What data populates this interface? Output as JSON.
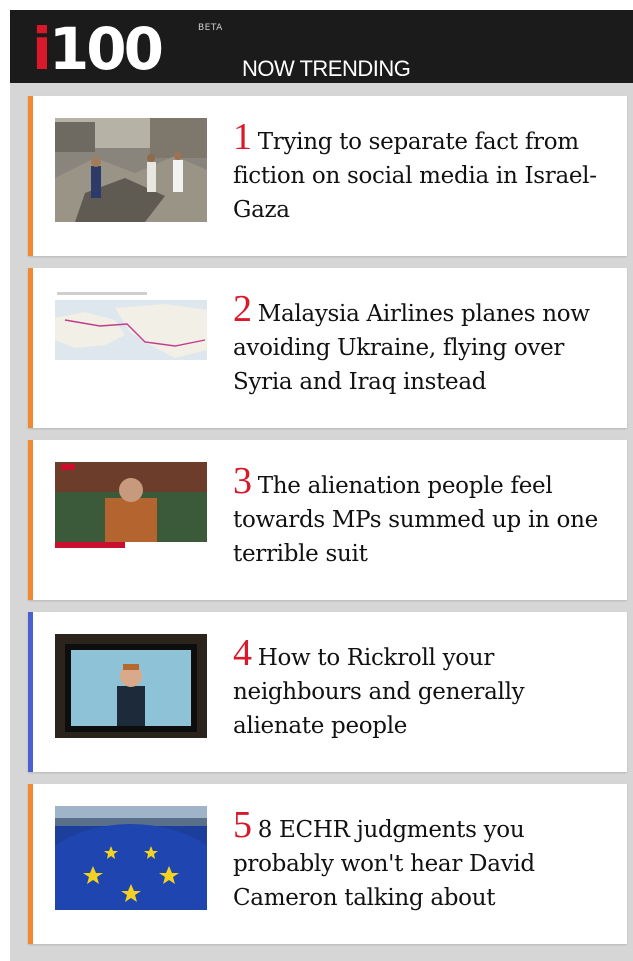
{
  "header": {
    "logo_prefix": "i",
    "logo_number": "100",
    "beta_label": "BETA",
    "tagline": "NOW TRENDING"
  },
  "colors": {
    "brand_red": "#d9182a",
    "accent_orange": "#f0892f",
    "accent_blue": "#4a5fd0",
    "header_bg": "#1b1b1b"
  },
  "articles": [
    {
      "rank": "1",
      "title": "Trying to separate fact from fiction on social media in Israel-Gaza"
    },
    {
      "rank": "2",
      "title": "Malaysia Airlines planes now avoiding Ukraine, flying over Syria and Iraq instead"
    },
    {
      "rank": "3",
      "title": "The alienation people feel towards MPs summed up in one terrible suit"
    },
    {
      "rank": "4",
      "title": "How to Rickroll your neighbours and generally alienate people"
    },
    {
      "rank": "5",
      "title": "8 ECHR judgments you probably won't hear David Cameron talking about"
    }
  ]
}
